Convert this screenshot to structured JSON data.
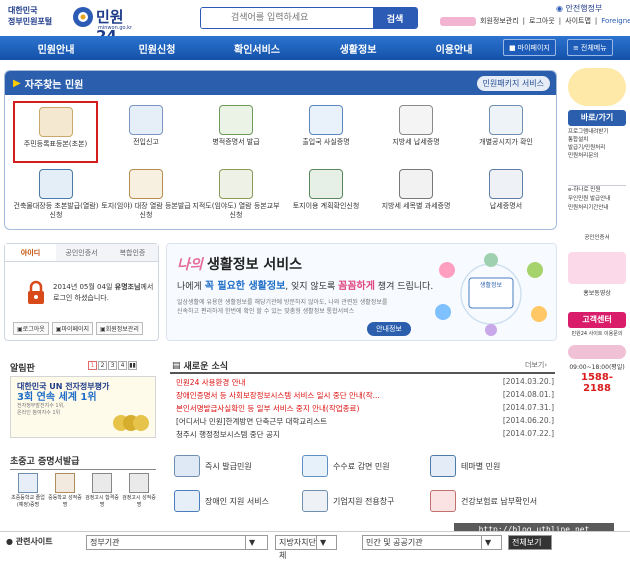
{
  "header": {
    "gov_name_line1": "대한민국",
    "gov_name_line2": "정부민원포털",
    "brand": "민원24",
    "brand_url": "minwon.go.kr",
    "search_placeholder": "검색어를 입력하세요",
    "search_button": "검색",
    "links": [
      "회원정보관리",
      "로그아웃",
      "사이트맵",
      "Foreigner"
    ],
    "ministry": "안전행정부"
  },
  "nav": {
    "items": [
      "민원안내",
      "민원신청",
      "확인서비스",
      "생활정보",
      "이용안내"
    ],
    "mypage": "마이페이지",
    "allmenu": "전체메뉴"
  },
  "freq": {
    "title": "자주찾는 민원",
    "package_link": "민원패키지 서비스",
    "row1": [
      "주민등록표등본(초본)",
      "전입신고",
      "병적증명서 발급",
      "출입국 사실증명",
      "지방세 납세증명",
      "개별공시지가 확인"
    ],
    "row2": [
      "건축물대장등 초본발급(열람)신청",
      "토지(임야) 대장 열람 등본발급신청",
      "지적도(임야도) 열람 등본교부신청",
      "토지이용 계획확인신청",
      "지방세 세목별 과세증명",
      "납세증명서"
    ]
  },
  "login": {
    "tabs": [
      "아이디",
      "공인인증서",
      "복합인증"
    ],
    "message_line1_pre": "2014년 05월 04일 ",
    "message_line1_highlight": "유명조님",
    "message_line1_post": "께서",
    "message_line2": "로그인 하셨습니다.",
    "buttons": [
      "로그아웃",
      "마이페이지",
      "회원정보관리"
    ]
  },
  "banner": {
    "logo_text": "나의",
    "title": "생활정보 서비스",
    "line_pre": "나에게 ",
    "line_h1": "꼭 필요한 생활정보",
    "line_mid": ", 잊지 않도록 ",
    "line_h2": "꼼꼼하게",
    "line_post": " 챙겨 드립니다.",
    "desc1": "일상생활에 유용한 생활정보를 해당기관에 방문하지 않아도, 나와 관련된 생활정보를",
    "desc2": "신속하고 편리하게 한번에 확인 할 수 있는 맞춤형 생활정보 통합서비스",
    "button": "안내정보",
    "badge": "생활정보"
  },
  "alim": {
    "title": "알림판",
    "pages": [
      "1",
      "2",
      "3",
      "4"
    ],
    "card_line1": "대한민국 UN 전자정부평가",
    "card_line2": "3회 연속 세계 1위",
    "card_small1": "전자정부발전지수 1위,",
    "card_small2": "온라인 참여지수 1위"
  },
  "news": {
    "title": "새로운 소식",
    "more": "더보기",
    "items": [
      {
        "text": "민원24 사용환경 안내",
        "date": "[2014.03.20.]",
        "red": true
      },
      {
        "text": "장애인증명서 등 사회보장정보시스템 서비스 일시 중단 안내(작...",
        "date": "[2014.08.01.]",
        "red": true
      },
      {
        "text": "본인서명발급사실확인 등 일부 서비스 중지 안내(작업종료)",
        "date": "[2014.07.31.]",
        "red": true
      },
      {
        "text": "[어디서나 민원]한계방면 단축근무 대학교리스트",
        "date": "[2014.06.20.]",
        "red": false
      },
      {
        "text": "청주시 행정정보시스템 중단 공지",
        "date": "[2014.07.22.]",
        "red": false
      }
    ]
  },
  "docs": {
    "title": "초중고 증명서발급",
    "items": [
      "초중등학교 졸업(예정)증명",
      "중등학교 성적증명",
      "검정고시 합격증명",
      "검정고시 성적증명"
    ]
  },
  "quick": [
    "즉시 발급민원",
    "수수료 감면 민원",
    "테마별 민원",
    "장애인 지원 서비스",
    "기업지원 전용창구",
    "건강보험료 납부확인서"
  ],
  "right": {
    "go_title": "바로/가기",
    "go_items": [
      "프로그램내려받기",
      "통합설치",
      "발급기/민원처리",
      "민원처리문의"
    ],
    "e_items": [
      "e-하나로 민원",
      "무인민원 발급안내",
      "민원처리기간안내"
    ],
    "badges": [
      "공인인증서",
      "홈페이지",
      "홍보동영상"
    ],
    "callcenter": "고객센터",
    "callcenter_sub": "민원24 사이트 이용문의",
    "hours": "09:00~18:00(평일)",
    "phone": "1588-2188"
  },
  "footer": {
    "label": "관련사이트",
    "selects": [
      "정부기관",
      "지방자치단체",
      "민간 및 공공기관"
    ],
    "go": "전체보기"
  },
  "watermark": "http://blog.uthline.net"
}
